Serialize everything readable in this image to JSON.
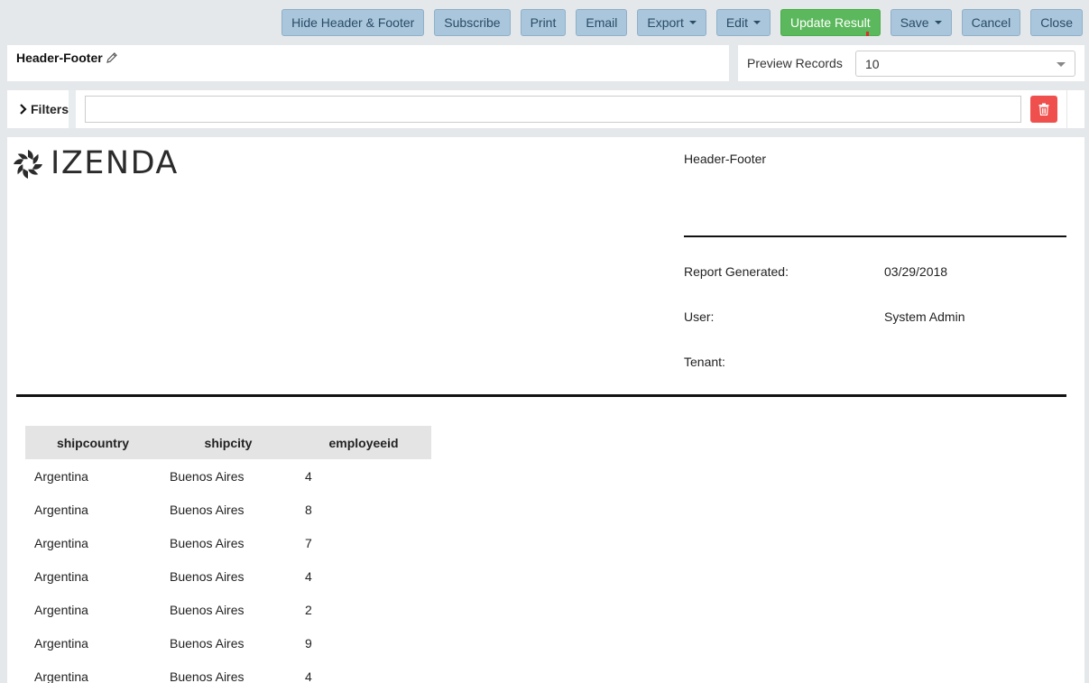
{
  "toolbar": {
    "hide_header_footer": "Hide Header & Footer",
    "subscribe": "Subscribe",
    "print": "Print",
    "email": "Email",
    "export": "Export",
    "edit": "Edit",
    "update_result": "Update Result",
    "save": "Save",
    "cancel": "Cancel",
    "close": "Close"
  },
  "report_name": "Header-Footer",
  "preview": {
    "label": "Preview Records",
    "value": "10"
  },
  "filters": {
    "label": "Filters",
    "value": ""
  },
  "header": {
    "logo_text": "IZENDA",
    "title": "Header-Footer",
    "report_generated_label": "Report Generated:",
    "report_generated_value": "03/29/2018",
    "user_label": "User:",
    "user_value": "System Admin",
    "tenant_label": "Tenant:",
    "tenant_value": ""
  },
  "table": {
    "columns": [
      "shipcountry",
      "shipcity",
      "employeeid"
    ],
    "rows": [
      [
        "Argentina",
        "Buenos Aires",
        "4"
      ],
      [
        "Argentina",
        "Buenos Aires",
        "8"
      ],
      [
        "Argentina",
        "Buenos Aires",
        "7"
      ],
      [
        "Argentina",
        "Buenos Aires",
        "4"
      ],
      [
        "Argentina",
        "Buenos Aires",
        "2"
      ],
      [
        "Argentina",
        "Buenos Aires",
        "9"
      ],
      [
        "Argentina",
        "Buenos Aires",
        "4"
      ]
    ]
  },
  "colors": {
    "toolbar_button": "#a9c6dc",
    "primary_button": "#5cb85c",
    "delete_button": "#f0504d",
    "background": "#e5e8eb"
  },
  "icons": [
    "pencil-icon",
    "chevron-right-icon",
    "trash-icon",
    "izenda-logo-icon",
    "caret-down-icon"
  ]
}
